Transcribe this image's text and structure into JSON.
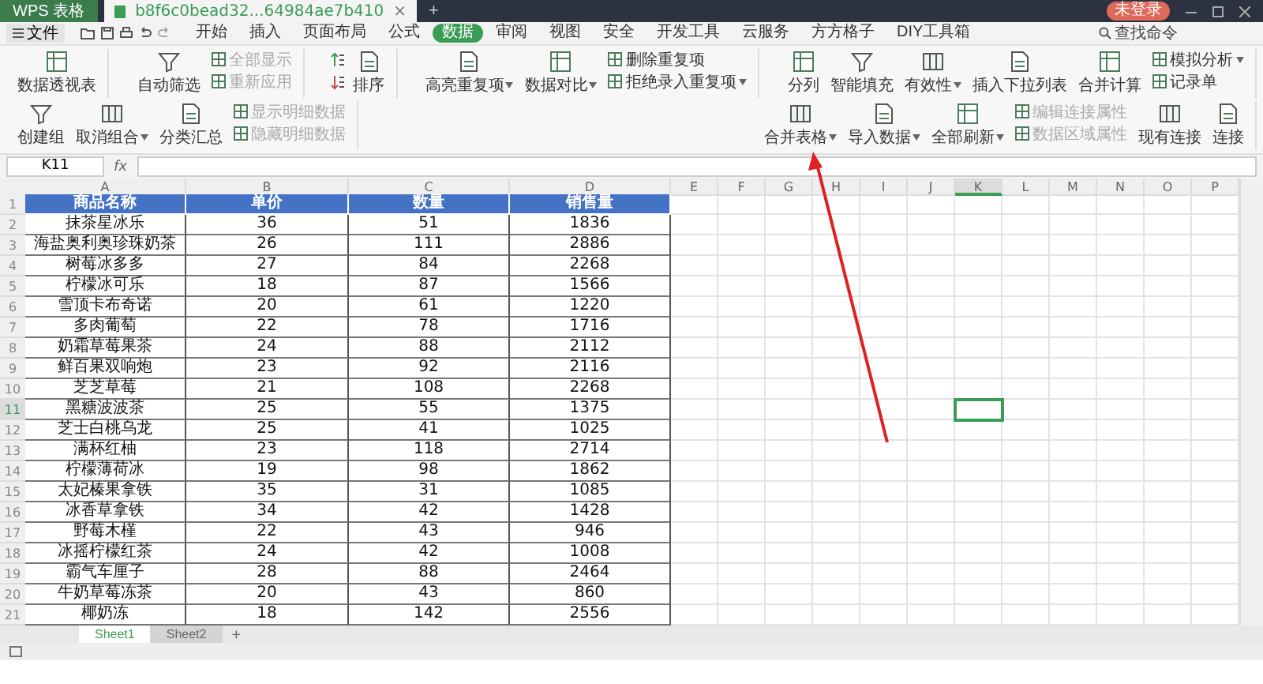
{
  "app_tab": "WPS 表格",
  "document_tab": {
    "title": "b8f6c0bead32...64984ae7b410",
    "close": "×"
  },
  "new_tab": "+",
  "login_badge": "未登录",
  "file_menu": "文件",
  "menu_tabs": [
    {
      "label": "开始",
      "selected": false
    },
    {
      "label": "插入",
      "selected": false
    },
    {
      "label": "页面布局",
      "selected": false
    },
    {
      "label": "公式",
      "selected": false
    },
    {
      "label": "数据",
      "selected": true
    },
    {
      "label": "审阅",
      "selected": false
    },
    {
      "label": "视图",
      "selected": false
    },
    {
      "label": "安全",
      "selected": false
    },
    {
      "label": "开发工具",
      "selected": false
    },
    {
      "label": "云服务",
      "selected": false
    },
    {
      "label": "方方格子",
      "selected": false
    },
    {
      "label": "DIY工具箱",
      "selected": false
    }
  ],
  "search_command": "查找命令",
  "ribbon_groups": [
    [
      {
        "kind": "large",
        "label": "数据透视表",
        "dropdown": false,
        "disabled": false
      }
    ],
    [
      {
        "kind": "large",
        "label": "自动筛选",
        "dropdown": false,
        "disabled": false
      },
      {
        "kind": "stack",
        "items": [
          {
            "label": "全部显示",
            "dropdown": false,
            "disabled": true
          },
          {
            "label": "重新应用",
            "dropdown": false,
            "disabled": true
          }
        ]
      }
    ],
    [
      {
        "kind": "icons"
      },
      {
        "kind": "large",
        "label": "排序",
        "dropdown": false,
        "disabled": false
      }
    ],
    [
      {
        "kind": "large",
        "label": "高亮重复项",
        "dropdown": true,
        "disabled": false
      },
      {
        "kind": "large",
        "label": "数据对比",
        "dropdown": true,
        "disabled": false
      },
      {
        "kind": "stack",
        "items": [
          {
            "label": "删除重复项",
            "dropdown": false,
            "disabled": false
          },
          {
            "label": "拒绝录入重复项",
            "dropdown": true,
            "disabled": false
          }
        ]
      }
    ],
    [
      {
        "kind": "large",
        "label": "分列",
        "dropdown": false,
        "disabled": false
      },
      {
        "kind": "large",
        "label": "智能填充",
        "dropdown": false,
        "disabled": false
      },
      {
        "kind": "large",
        "label": "有效性",
        "dropdown": true,
        "disabled": false
      },
      {
        "kind": "large",
        "label": "插入下拉列表",
        "dropdown": false,
        "disabled": false
      },
      {
        "kind": "large",
        "label": "合并计算",
        "dropdown": false,
        "disabled": false
      },
      {
        "kind": "stack",
        "items": [
          {
            "label": "模拟分析",
            "dropdown": true,
            "disabled": false
          },
          {
            "label": "记录单",
            "dropdown": false,
            "disabled": false
          }
        ]
      }
    ],
    [
      {
        "kind": "large",
        "label": "创建组",
        "dropdown": false,
        "disabled": false
      },
      {
        "kind": "large",
        "label": "取消组合",
        "dropdown": true,
        "disabled": false
      },
      {
        "kind": "large",
        "label": "分类汇总",
        "dropdown": false,
        "disabled": false
      },
      {
        "kind": "stack",
        "items": [
          {
            "label": "显示明细数据",
            "dropdown": false,
            "disabled": true
          },
          {
            "label": "隐藏明细数据",
            "dropdown": false,
            "disabled": true
          }
        ]
      }
    ],
    [
      {
        "kind": "large",
        "label": "合并表格",
        "dropdown": true,
        "disabled": false
      },
      {
        "kind": "large",
        "label": "导入数据",
        "dropdown": true,
        "disabled": false
      },
      {
        "kind": "large",
        "label": "全部刷新",
        "dropdown": true,
        "disabled": false
      },
      {
        "kind": "stack",
        "items": [
          {
            "label": "编辑连接属性",
            "dropdown": false,
            "disabled": true
          },
          {
            "label": "数据区域属性",
            "dropdown": false,
            "disabled": true
          }
        ]
      },
      {
        "kind": "large",
        "label": "现有连接",
        "dropdown": false,
        "disabled": false
      },
      {
        "kind": "large",
        "label": "连接",
        "dropdown": false,
        "disabled": false
      }
    ]
  ],
  "name_box": "K11",
  "formula_label": "fx",
  "column_headers": [
    {
      "label": "A",
      "selected": false
    },
    {
      "label": "B",
      "selected": false
    },
    {
      "label": "C",
      "selected": false
    },
    {
      "label": "D",
      "selected": false
    },
    {
      "label": "E",
      "selected": false
    },
    {
      "label": "F",
      "selected": false
    },
    {
      "label": "G",
      "selected": false
    },
    {
      "label": "H",
      "selected": false
    },
    {
      "label": "I",
      "selected": false
    },
    {
      "label": "J",
      "selected": false
    },
    {
      "label": "K",
      "selected": true
    },
    {
      "label": "L",
      "selected": false
    },
    {
      "label": "M",
      "selected": false
    },
    {
      "label": "N",
      "selected": false
    },
    {
      "label": "O",
      "selected": false
    },
    {
      "label": "P",
      "selected": false
    }
  ],
  "rows": [
    {
      "number": "1",
      "kind": "header",
      "selected": false,
      "cells": [
        "商品名称",
        "单价",
        "数量",
        "销售量"
      ]
    },
    {
      "number": "2",
      "kind": "data",
      "selected": false,
      "cells": [
        "抹茶星冰乐",
        "36",
        "51",
        "1836"
      ]
    },
    {
      "number": "3",
      "kind": "data",
      "selected": false,
      "cells": [
        "海盐奥利奥珍珠奶茶",
        "26",
        "111",
        "2886"
      ]
    },
    {
      "number": "4",
      "kind": "data",
      "selected": false,
      "cells": [
        "树莓冰多多",
        "27",
        "84",
        "2268"
      ]
    },
    {
      "number": "5",
      "kind": "data",
      "selected": false,
      "cells": [
        "柠檬冰可乐",
        "18",
        "87",
        "1566"
      ]
    },
    {
      "number": "6",
      "kind": "data",
      "selected": false,
      "cells": [
        "雪顶卡布奇诺",
        "20",
        "61",
        "1220"
      ]
    },
    {
      "number": "7",
      "kind": "data",
      "selected": false,
      "cells": [
        "多肉葡萄",
        "22",
        "78",
        "1716"
      ]
    },
    {
      "number": "8",
      "kind": "data",
      "selected": false,
      "cells": [
        "奶霜草莓果茶",
        "24",
        "88",
        "2112"
      ]
    },
    {
      "number": "9",
      "kind": "data",
      "selected": false,
      "cells": [
        "鲜百果双响炮",
        "23",
        "92",
        "2116"
      ]
    },
    {
      "number": "10",
      "kind": "data",
      "selected": false,
      "cells": [
        "芝芝草莓",
        "21",
        "108",
        "2268"
      ]
    },
    {
      "number": "11",
      "kind": "data",
      "selected": true,
      "cells": [
        "黑糖波波茶",
        "25",
        "55",
        "1375"
      ]
    },
    {
      "number": "12",
      "kind": "data",
      "selected": false,
      "cells": [
        "芝士白桃乌龙",
        "25",
        "41",
        "1025"
      ]
    },
    {
      "number": "13",
      "kind": "data",
      "selected": false,
      "cells": [
        "满杯红柚",
        "23",
        "118",
        "2714"
      ]
    },
    {
      "number": "14",
      "kind": "data",
      "selected": false,
      "cells": [
        "柠檬薄荷冰",
        "19",
        "98",
        "1862"
      ]
    },
    {
      "number": "15",
      "kind": "data",
      "selected": false,
      "cells": [
        "太妃榛果拿铁",
        "35",
        "31",
        "1085"
      ]
    },
    {
      "number": "16",
      "kind": "data",
      "selected": false,
      "cells": [
        "冰香草拿铁",
        "34",
        "42",
        "1428"
      ]
    },
    {
      "number": "17",
      "kind": "data",
      "selected": false,
      "cells": [
        "野莓木槿",
        "22",
        "43",
        "946"
      ]
    },
    {
      "number": "18",
      "kind": "data",
      "selected": false,
      "cells": [
        "冰摇柠檬红茶",
        "24",
        "42",
        "1008"
      ]
    },
    {
      "number": "19",
      "kind": "data",
      "selected": false,
      "cells": [
        "霸气车厘子",
        "28",
        "88",
        "2464"
      ]
    },
    {
      "number": "20",
      "kind": "data",
      "selected": false,
      "cells": [
        "牛奶草莓冻茶",
        "20",
        "43",
        "860"
      ]
    },
    {
      "number": "21",
      "kind": "data",
      "selected": false,
      "cells": [
        "椰奶冻",
        "18",
        "142",
        "2556"
      ]
    }
  ],
  "sheet_tabs": [
    {
      "label": "Sheet1",
      "selected": true
    },
    {
      "label": "Sheet2",
      "selected": false
    }
  ],
  "add_sheet": "+"
}
